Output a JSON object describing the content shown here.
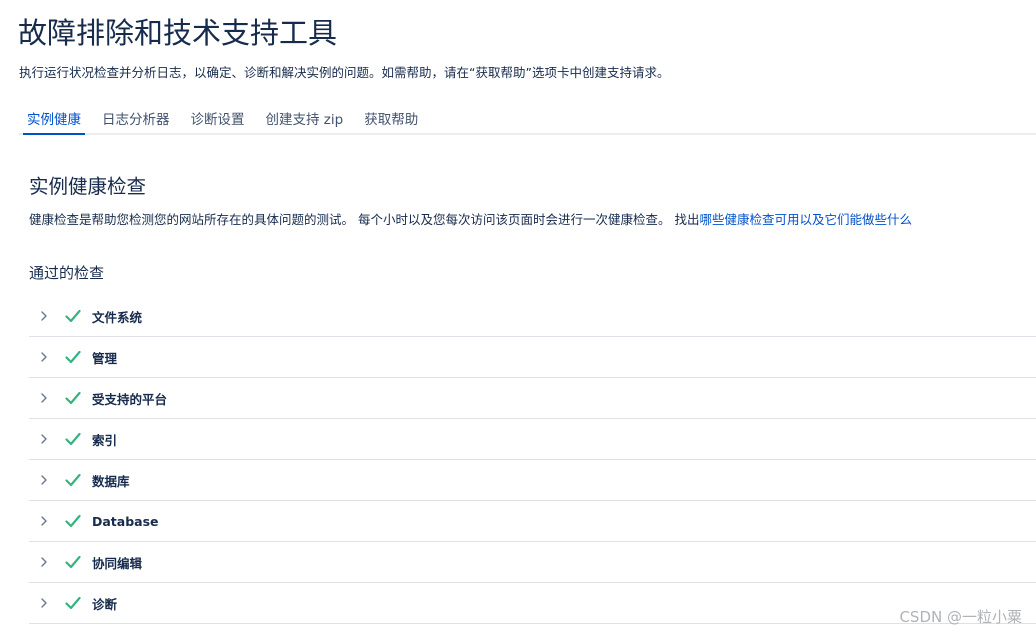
{
  "header": {
    "title": "故障排除和技术支持工具",
    "description": "执行运行状况检查并分析日志，以确定、诊断和解决实例的问题。如需帮助，请在“获取帮助”选项卡中创建支持请求。"
  },
  "tabs": [
    {
      "label": "实例健康",
      "active": true
    },
    {
      "label": "日志分析器",
      "active": false
    },
    {
      "label": "诊断设置",
      "active": false
    },
    {
      "label": "创建支持 zip",
      "active": false
    },
    {
      "label": "获取帮助",
      "active": false
    }
  ],
  "health": {
    "title": "实例健康检查",
    "description": "健康检查是帮助您检测您的网站所存在的具体问题的测试。 每个小时以及您每次访问该页面时会进行一次健康检查。 找出",
    "link_text": "哪些健康检查可用以及它们能做些什么",
    "passed_title": "通过的检查",
    "checks": [
      {
        "label": "文件系统"
      },
      {
        "label": "管理"
      },
      {
        "label": "受支持的平台"
      },
      {
        "label": "索引"
      },
      {
        "label": "数据库"
      },
      {
        "label": "Database"
      },
      {
        "label": "协同编辑"
      },
      {
        "label": "诊断"
      }
    ]
  },
  "watermark": "CSDN @一粒小粟",
  "colors": {
    "accent": "#0052cc",
    "success": "#36b37e",
    "text": "#172b4d"
  },
  "icons": {
    "expand": "chevron-right-icon",
    "status": "check-icon"
  }
}
